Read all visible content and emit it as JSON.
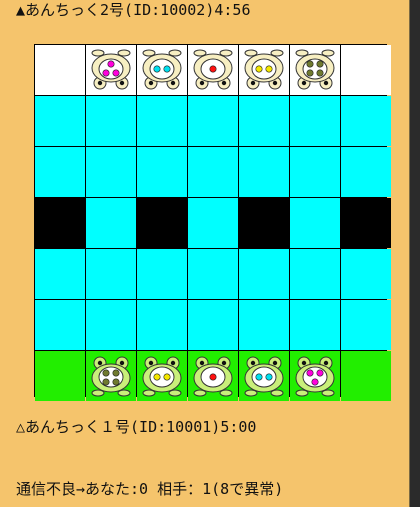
{
  "top_status": "▲あんちっく2号(ID:10002)4:56",
  "bottom_player": "△あんちっく１号(ID:10001)5:00",
  "connection_status": "通信不良→あなた:0 相手：1(8で異常)",
  "colors": {
    "frame": "#f5c46c",
    "top_goal": "#ffffff",
    "bottom_goal": "#22ee00",
    "water": "#00ffff",
    "block": "#000000",
    "red": "#ff1010",
    "yellow": "#f5e800",
    "cyan": "#00e0f0",
    "magenta": "#ff00dd",
    "olive": "#6f7a2f"
  },
  "board": {
    "rows": [
      [
        "top_goal",
        "top_goal",
        "top_goal",
        "top_goal",
        "top_goal",
        "top_goal",
        "top_goal"
      ],
      [
        "water",
        "water",
        "water",
        "water",
        "water",
        "water",
        "water"
      ],
      [
        "water",
        "water",
        "water",
        "water",
        "water",
        "water",
        "water"
      ],
      [
        "block",
        "water",
        "block",
        "water",
        "block",
        "water",
        "block"
      ],
      [
        "water",
        "water",
        "water",
        "water",
        "water",
        "water",
        "water"
      ],
      [
        "water",
        "water",
        "water",
        "water",
        "water",
        "water",
        "water"
      ],
      [
        "bottom_goal",
        "bottom_goal",
        "bottom_goal",
        "bottom_goal",
        "bottom_goal",
        "bottom_goal",
        "bottom_goal"
      ]
    ],
    "pieces": [
      {
        "row": 0,
        "col": 1,
        "side": "opponent",
        "dots": 3,
        "color": "magenta"
      },
      {
        "row": 0,
        "col": 2,
        "side": "opponent",
        "dots": 2,
        "color": "cyan"
      },
      {
        "row": 0,
        "col": 3,
        "side": "opponent",
        "dots": 1,
        "color": "red"
      },
      {
        "row": 0,
        "col": 4,
        "side": "opponent",
        "dots": 2,
        "color": "yellow"
      },
      {
        "row": 0,
        "col": 5,
        "side": "opponent",
        "dots": 4,
        "color": "olive"
      },
      {
        "row": 6,
        "col": 1,
        "side": "player",
        "dots": 4,
        "color": "olive"
      },
      {
        "row": 6,
        "col": 2,
        "side": "player",
        "dots": 2,
        "color": "yellow"
      },
      {
        "row": 6,
        "col": 3,
        "side": "player",
        "dots": 1,
        "color": "red"
      },
      {
        "row": 6,
        "col": 4,
        "side": "player",
        "dots": 2,
        "color": "cyan"
      },
      {
        "row": 6,
        "col": 5,
        "side": "player",
        "dots": 3,
        "color": "magenta"
      }
    ]
  }
}
